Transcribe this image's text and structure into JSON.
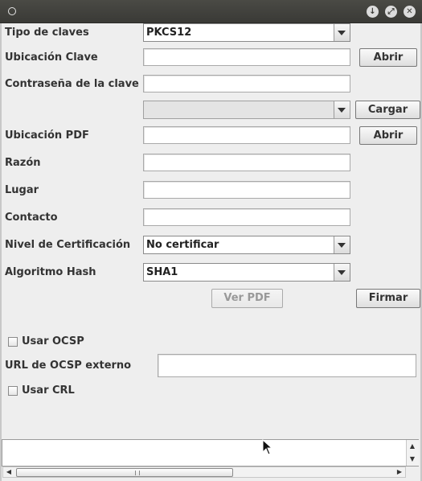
{
  "titlebar": {
    "app_icon": "circle-icon",
    "buttons": [
      "minimize-icon",
      "maximize-icon",
      "close-icon"
    ]
  },
  "form": {
    "tipo_claves": {
      "label": "Tipo de claves",
      "value": "PKCS12"
    },
    "ubicacion_clave": {
      "label": "Ubicación Clave",
      "value": "",
      "button": "Abrir"
    },
    "contrasena": {
      "label": "Contraseña de la clave",
      "value": ""
    },
    "alias": {
      "value": "",
      "button": "Cargar"
    },
    "ubicacion_pdf": {
      "label": "Ubicación PDF",
      "value": "",
      "button": "Abrir"
    },
    "razon": {
      "label": "Razón",
      "value": ""
    },
    "lugar": {
      "label": "Lugar",
      "value": ""
    },
    "contacto": {
      "label": "Contacto",
      "value": ""
    },
    "nivel_certificacion": {
      "label": "Nivel de Certificación",
      "value": "No certificar"
    },
    "algoritmo_hash": {
      "label": "Algoritmo Hash",
      "value": "SHA1"
    }
  },
  "actions": {
    "ver_pdf": "Ver PDF",
    "firmar": "Firmar"
  },
  "ocsp": {
    "usar_ocsp": "Usar OCSP",
    "url_label": "URL de OCSP externo",
    "url_value": "",
    "usar_crl": "Usar CRL"
  },
  "log": {
    "text": ""
  },
  "colors": {
    "titlebar": "#3f3f3b",
    "background": "#eeeeee",
    "field_border": "#a9a9a9"
  }
}
